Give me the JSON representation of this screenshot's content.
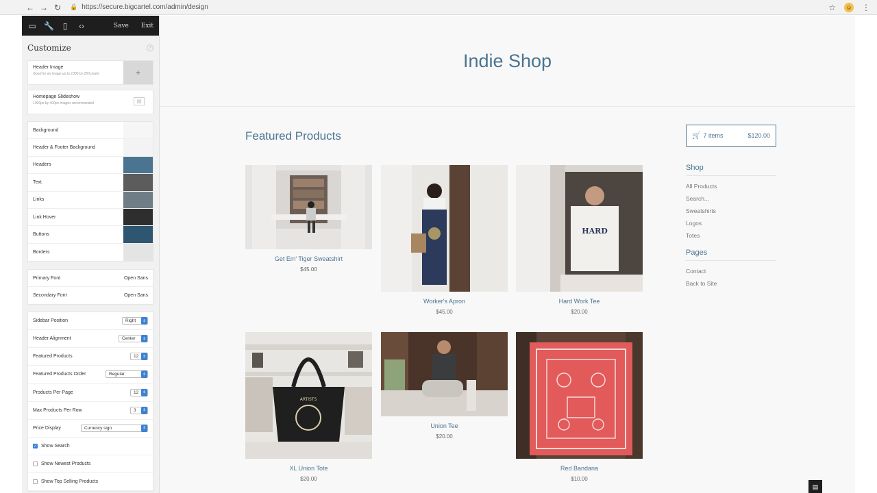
{
  "browser": {
    "url": "https://secure.bigcartel.com/admin/design"
  },
  "toolbar": {
    "save_label": "Save",
    "exit_label": "Exit"
  },
  "customize": {
    "title": "Customize",
    "header_image": {
      "label": "Header Image",
      "sub": "Good for an image up to 1300 by 250 pixels"
    },
    "slideshow": {
      "label": "Homepage Slideshow",
      "sub": "1000px by 400px images recommended"
    },
    "colors": [
      {
        "label": "Background",
        "color": "#f6f6f6"
      },
      {
        "label": "Header & Footer Background",
        "color": "#f3f3f3"
      },
      {
        "label": "Headers",
        "color": "#4a7490"
      },
      {
        "label": "Text",
        "color": "#5c5c5c"
      },
      {
        "label": "Links",
        "color": "#6f7d86"
      },
      {
        "label": "Link Hover",
        "color": "#2e2e2e"
      },
      {
        "label": "Buttons",
        "color": "#2f5670"
      },
      {
        "label": "Borders",
        "color": "#e4e4e4"
      }
    ],
    "fonts": [
      {
        "label": "Primary Font",
        "value": "Open Sans"
      },
      {
        "label": "Secondary Font",
        "value": "Open Sans"
      }
    ],
    "options": [
      {
        "label": "Sidebar Position",
        "value": "Right"
      },
      {
        "label": "Header Alignment",
        "value": "Center"
      },
      {
        "label": "Featured Products",
        "value": "12"
      },
      {
        "label": "Featured Products Order",
        "value": "Regular"
      },
      {
        "label": "Products Per Page",
        "value": "12"
      },
      {
        "label": "Max Products Per Row",
        "value": "3"
      },
      {
        "label": "Price Display",
        "value": "Currency sign"
      }
    ],
    "checks": [
      {
        "label": "Show Search",
        "checked": true
      },
      {
        "label": "Show Newest Products",
        "checked": false
      },
      {
        "label": "Show Top Selling Products",
        "checked": false
      }
    ]
  },
  "shop": {
    "title": "Indie Shop",
    "featured_heading": "Featured Products",
    "cart": {
      "items": "7 items",
      "total": "$120.00"
    },
    "products": [
      {
        "name": "Get Em' Tiger Sweatshirt",
        "price": "$45.00"
      },
      {
        "name": "Worker's Apron",
        "price": "$45.00"
      },
      {
        "name": "Hard Work Tee",
        "price": "$20.00"
      },
      {
        "name": "XL Union Tote",
        "price": "$20.00"
      },
      {
        "name": "Union Tee",
        "price": "$20.00"
      },
      {
        "name": "Red Bandana",
        "price": "$10.00"
      }
    ],
    "sidebar": {
      "shop_heading": "Shop",
      "shop_links": [
        "All Products",
        "Search...",
        "Sweatshirts",
        "Logos",
        "Totes"
      ],
      "pages_heading": "Pages",
      "pages_links": [
        "Contact",
        "Back to Site"
      ]
    }
  }
}
